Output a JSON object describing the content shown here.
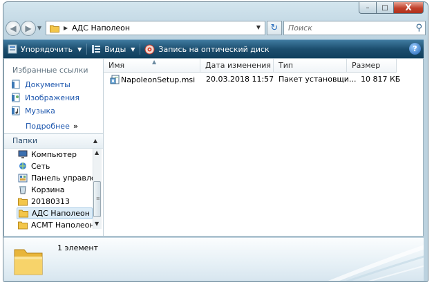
{
  "window": {
    "title_buttons": {
      "minimize": "–",
      "maximize": "□",
      "close": "X"
    }
  },
  "nav": {
    "back_glyph": "◀",
    "forward_glyph": "▶",
    "path_sep": "▶",
    "path": "АДС Наполеон",
    "dropdown_glyph": "▼",
    "refresh_glyph": "↻",
    "search_placeholder": "Поиск",
    "search_glyph": "⚲"
  },
  "toolbar": {
    "organize": "Упорядочить",
    "views": "Виды",
    "burn": "Запись на оптический диск",
    "help": "?"
  },
  "left": {
    "favorites_title": "Избранные ссылки",
    "favorites": [
      {
        "label": "Документы",
        "icon": "documents-icon"
      },
      {
        "label": "Изображения",
        "icon": "pictures-icon"
      },
      {
        "label": "Музыка",
        "icon": "music-icon"
      }
    ],
    "more": "Подробнее",
    "more_glyph": "»",
    "folders_title": "Папки",
    "folders_arrow": "▲",
    "tree": [
      {
        "label": "Компьютер",
        "icon": "computer-icon"
      },
      {
        "label": "Сеть",
        "icon": "network-icon"
      },
      {
        "label": "Панель управления",
        "icon": "control-panel-icon"
      },
      {
        "label": "Корзина",
        "icon": "recycle-bin-icon"
      },
      {
        "label": "20180313",
        "icon": "folder-icon"
      },
      {
        "label": "АДС Наполеон",
        "icon": "folder-icon",
        "selected": true
      },
      {
        "label": "АСМТ Наполеон",
        "icon": "folder-icon"
      }
    ]
  },
  "list": {
    "columns": [
      "Имя",
      "Дата изменения",
      "Тип",
      "Размер"
    ],
    "sort_glyph": "▲",
    "rows": [
      {
        "name": "NapoleonSetup.msi",
        "date": "20.03.2018 11:57",
        "type": "Пакет установщи...",
        "size": "10 817 КБ"
      }
    ]
  },
  "details": {
    "count": "1 элемент"
  },
  "colors": {
    "toolbar": "#1c4e6e",
    "link": "#1b55ad",
    "selection": "#dcecf7"
  }
}
